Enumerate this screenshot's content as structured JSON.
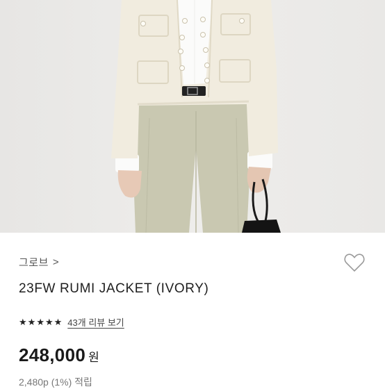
{
  "product": {
    "brand": "그로브",
    "brand_chevron": ">",
    "name": "23FW RUMI JACKET (IVORY)",
    "rating_stars": 5,
    "review_link": "43개 리뷰 보기",
    "price": "248,000",
    "currency": "원",
    "points": "2,480p (1%) 적립"
  },
  "icons": {
    "star": "star-icon",
    "wishlist": "heart-outline-icon",
    "brand_chevron": "chevron-right-icon"
  },
  "colors": {
    "photo_bg": "#ecebe9",
    "jacket": "#f1ecdf",
    "pants": "#c9c8b1",
    "text_primary": "#1e1e1e"
  }
}
